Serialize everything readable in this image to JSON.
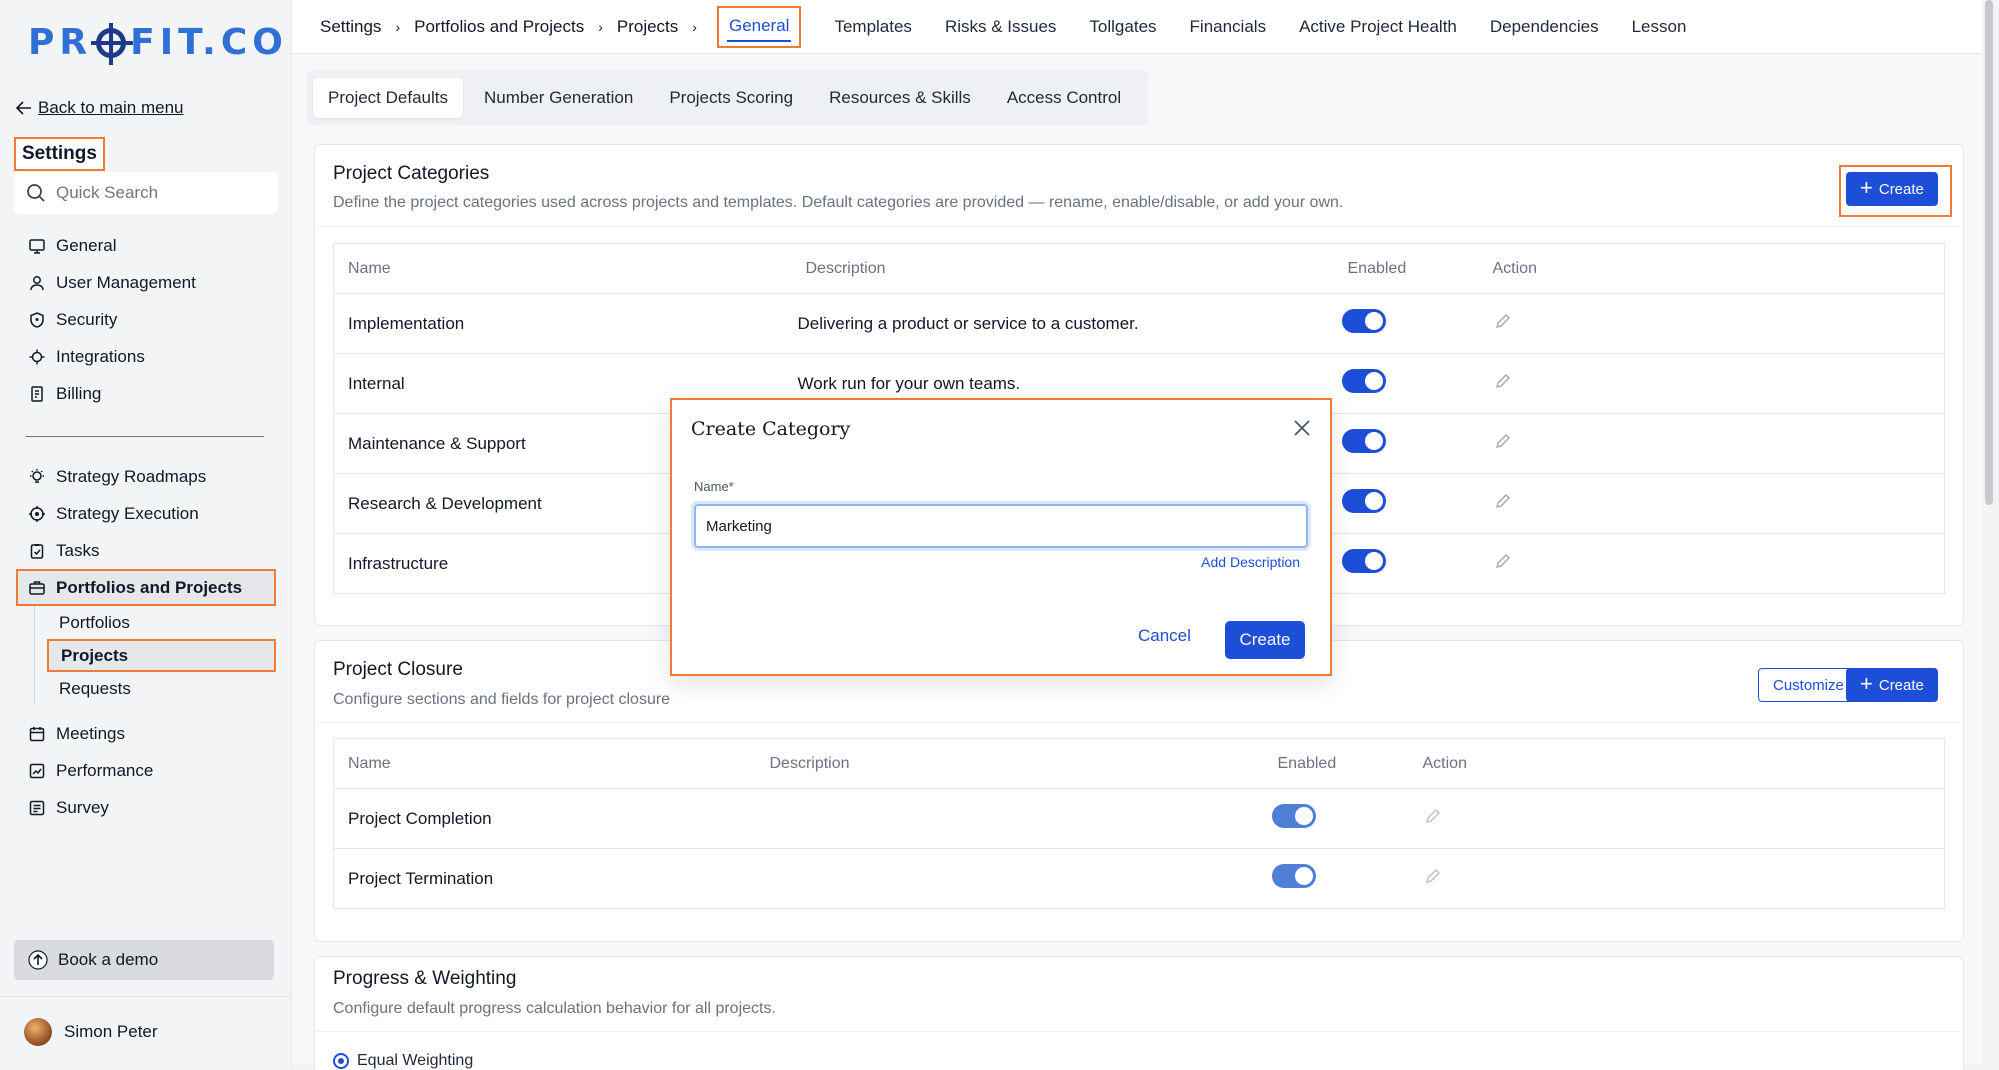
{
  "logo": "PROFIT.CO",
  "sidebar": {
    "back_label": "Back to main menu",
    "settings_title": "Settings",
    "search_placeholder": "Quick Search",
    "items_top": [
      "General",
      "User Management",
      "Security",
      "Integrations",
      "Billing"
    ],
    "items_mid": [
      "Strategy Roadmaps",
      "Strategy Execution",
      "Tasks",
      "Portfolios and Projects"
    ],
    "sub_items": [
      "Portfolios",
      "Projects",
      "Requests"
    ],
    "items_bottom": [
      "Meetings",
      "Performance",
      "Survey"
    ],
    "book_demo": "Book a demo",
    "user_name": "Simon Peter"
  },
  "breadcrumb": [
    "Settings",
    "Portfolios and Projects",
    "Projects"
  ],
  "top_tabs": [
    "General",
    "Templates",
    "Risks & Issues",
    "Tollgates",
    "Financials",
    "Active Project Health",
    "Dependencies",
    "Lesson"
  ],
  "sub_tabs": [
    "Project Defaults",
    "Number Generation",
    "Projects Scoring",
    "Resources & Skills",
    "Access Control"
  ],
  "categories": {
    "title": "Project Categories",
    "subtitle": "Define the project categories used across projects and templates. Default categories are provided — rename, enable/disable, or add your own.",
    "create_label": "Create",
    "columns": [
      "Name",
      "Description",
      "Enabled",
      "Action"
    ],
    "rows": [
      {
        "name": "Implementation",
        "description": "Delivering a product or service to a customer."
      },
      {
        "name": "Internal",
        "description": "Work run for your own teams."
      },
      {
        "name": "Maintenance & Support",
        "description": ""
      },
      {
        "name": "Research & Development",
        "description": ""
      },
      {
        "name": "Infrastructure",
        "description": ""
      }
    ]
  },
  "closure": {
    "title": "Project Closure",
    "subtitle": "Configure sections and fields for project closure",
    "customize_label": "Customize",
    "create_label": "Create",
    "columns": [
      "Name",
      "Description",
      "Enabled",
      "Action"
    ],
    "rows": [
      {
        "name": "Project Completion",
        "description": ""
      },
      {
        "name": "Project Termination",
        "description": ""
      }
    ]
  },
  "progress": {
    "title": "Progress & Weighting",
    "subtitle": "Configure default progress calculation behavior for all projects.",
    "option": "Equal Weighting"
  },
  "modal": {
    "title": "Create Category",
    "name_label": "Name*",
    "name_value": "Marketing",
    "add_description": "Add Description",
    "cancel_label": "Cancel",
    "create_label": "Create"
  },
  "colors": {
    "accent": "#1d4ed8",
    "highlight": "#f07b34"
  }
}
